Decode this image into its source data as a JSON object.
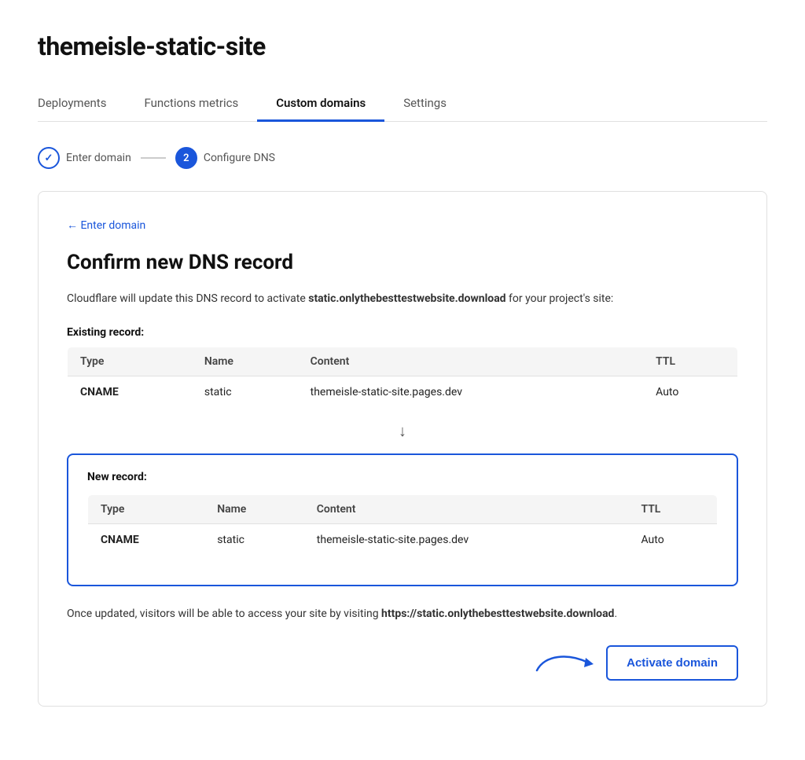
{
  "page": {
    "title": "themeisle-static-site"
  },
  "tabs": [
    {
      "id": "deployments",
      "label": "Deployments",
      "active": false
    },
    {
      "id": "functions-metrics",
      "label": "Functions metrics",
      "active": false
    },
    {
      "id": "custom-domains",
      "label": "Custom domains",
      "active": true
    },
    {
      "id": "settings",
      "label": "Settings",
      "active": false
    }
  ],
  "stepper": {
    "step1": {
      "label": "Enter domain",
      "state": "completed",
      "number": "1"
    },
    "step2": {
      "label": "Configure DNS",
      "state": "active",
      "number": "2"
    }
  },
  "card": {
    "back_link": "← Enter domain",
    "title": "Confirm new DNS record",
    "description_prefix": "Cloudflare will update this DNS record to activate ",
    "domain_bold": "static.onlythebesttestwebsite.download",
    "description_suffix": " for your project's site:",
    "existing_record_label": "Existing record:",
    "new_record_label": "New record:",
    "table_headers": {
      "type": "Type",
      "name": "Name",
      "content": "Content",
      "ttl": "TTL"
    },
    "existing_row": {
      "type": "CNAME",
      "name": "static",
      "content": "themeisle-static-site.pages.dev",
      "ttl": "Auto"
    },
    "new_row": {
      "type": "CNAME",
      "name": "static",
      "content": "themeisle-static-site.pages.dev",
      "ttl": "Auto"
    },
    "footer_text_prefix": "Once updated, visitors will be able to access your site by visiting ",
    "footer_url": "https://static.onlythebesttestwebsite.download",
    "footer_text_suffix": ".",
    "activate_button": "Activate domain"
  }
}
